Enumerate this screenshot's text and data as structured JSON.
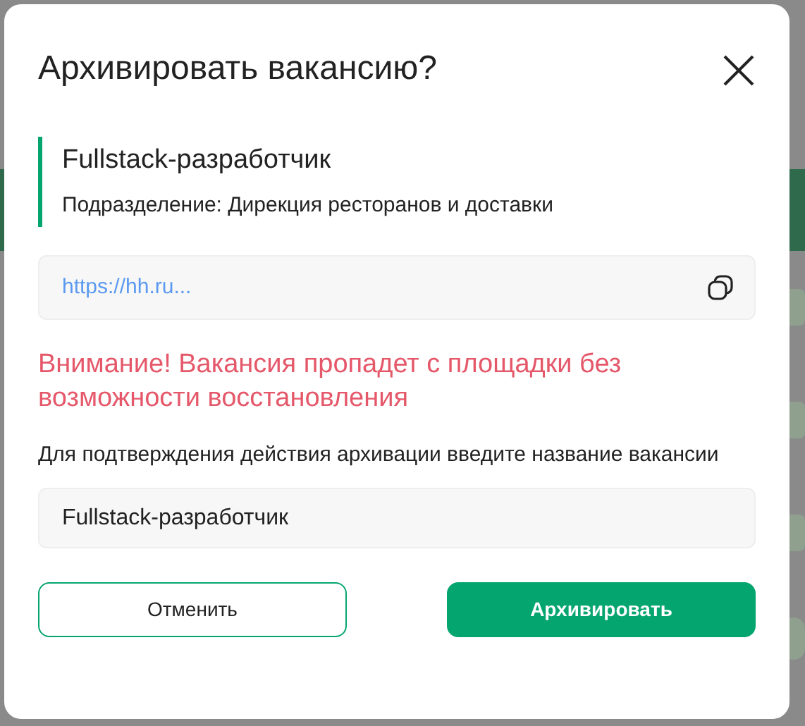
{
  "dialog": {
    "title": "Архивировать вакансию?"
  },
  "vacancy": {
    "name": "Fullstack-разработчик",
    "department": "Подразделение: Дирекция ресторанов и доставки"
  },
  "link": {
    "value": "https://hh.ru..."
  },
  "warning": "Внимание! Вакансия пропадет с площадки без возможности восстановления",
  "confirm_label": "Для подтверждения действия архивации введите название вакансии",
  "confirm_input": {
    "value": "Fullstack-разработчик"
  },
  "buttons": [
    {
      "label": "Отменить",
      "kind": "secondary"
    },
    {
      "label": "Архивировать",
      "kind": "primary"
    }
  ]
}
